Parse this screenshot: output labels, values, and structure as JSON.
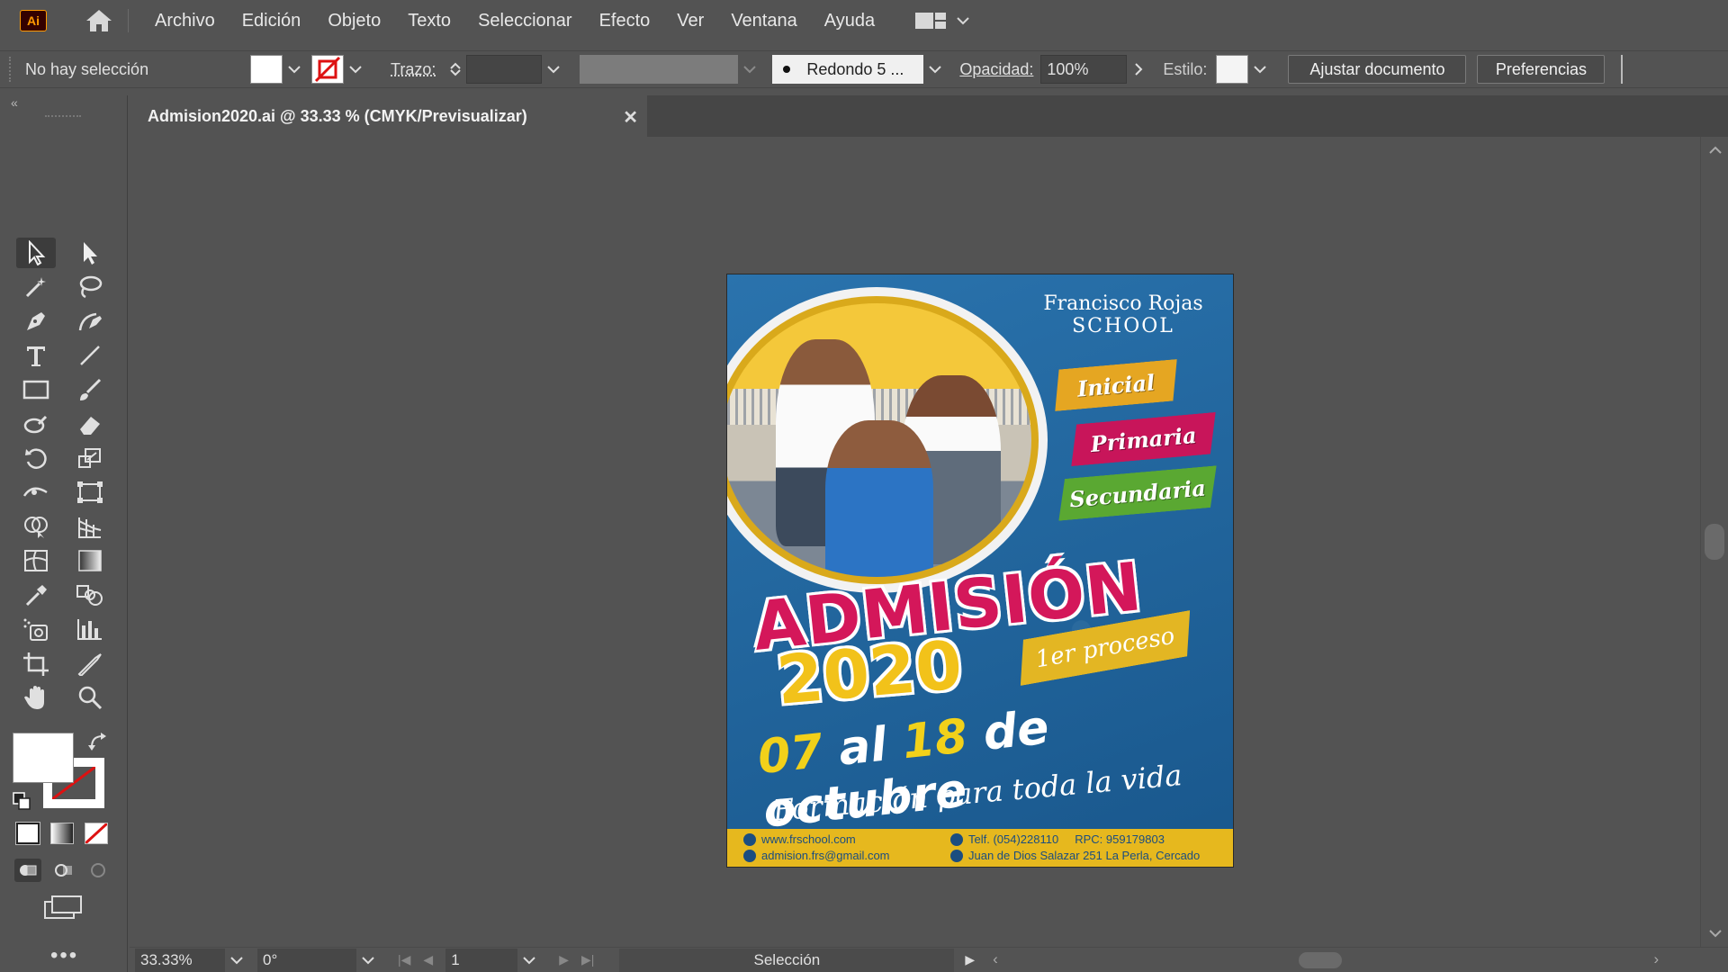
{
  "app": {
    "logo_text": "Ai"
  },
  "menu": {
    "items": [
      "Archivo",
      "Edición",
      "Objeto",
      "Texto",
      "Seleccionar",
      "Efecto",
      "Ver",
      "Ventana",
      "Ayuda"
    ]
  },
  "control": {
    "selection_status": "No hay selección",
    "stroke_label": "Trazo:",
    "brush_label": "Redondo 5 ...",
    "opacity_label": "Opacidad:",
    "opacity_value": "100%",
    "style_label": "Estilo:",
    "adjust_doc_label": "Ajustar documento",
    "prefs_label": "Preferencias"
  },
  "document": {
    "tab_title": "Admision2020.ai @ 33.33 % (CMYK/Previsualizar)",
    "close_glyph": "✕"
  },
  "poster": {
    "school_line1": "Francisco Rojas",
    "school_line2": "SCHOOL",
    "levels": [
      "Inicial",
      "Primaria",
      "Secundaria"
    ],
    "headline": "ADMISIÓN",
    "year": "2020",
    "process": "1er proceso",
    "date_start": "07",
    "date_mid": "al",
    "date_end": "18",
    "date_rest": "de octubre",
    "tagline": "Formación para toda la vida",
    "footer": {
      "web": "www.frschool.com",
      "email": "admision.frs@gmail.com",
      "phone": "Telf. (054)228110",
      "rpc": "RPC: 959179803",
      "address": "Juan de Dios Salazar 251 La Perla, Cercado"
    }
  },
  "status": {
    "zoom": "33.33%",
    "rotation": "0°",
    "page": "1",
    "tool_name": "Selección"
  },
  "colors": {
    "ui_bg": "#535353",
    "accent_orange": "#ff9a00",
    "poster_blue": "#1c5f97",
    "tag_inicial": "#e5a622",
    "tag_primaria": "#c8155a",
    "tag_secundaria": "#5aa832"
  }
}
